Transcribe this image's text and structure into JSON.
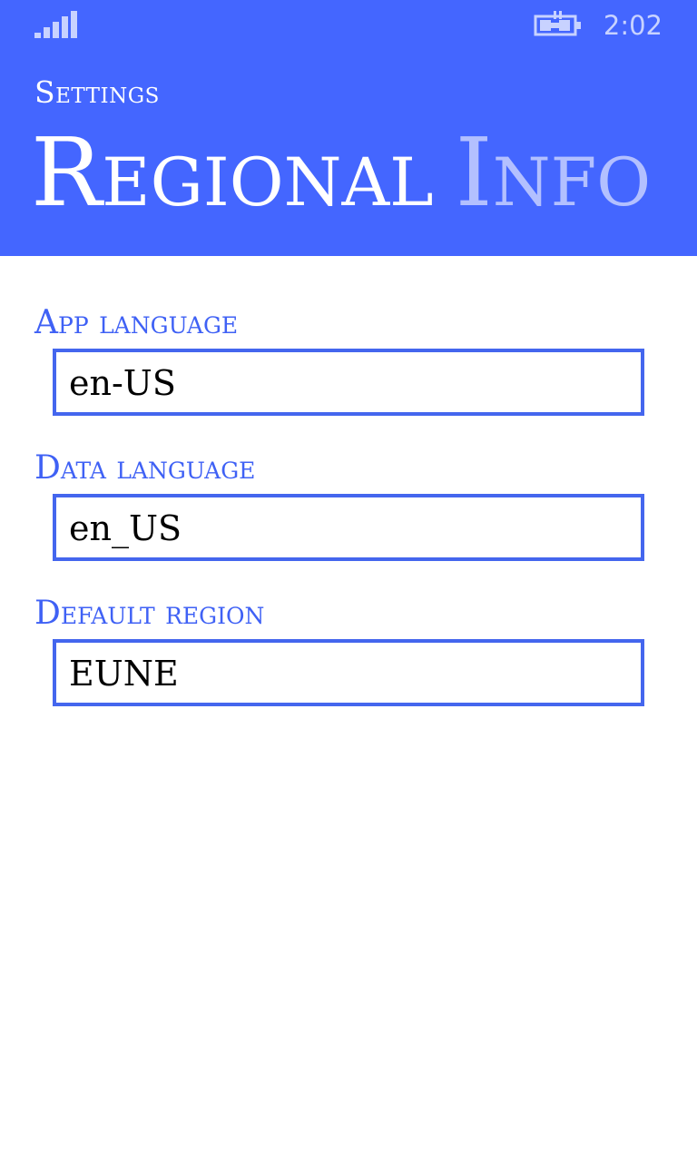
{
  "status_bar": {
    "time": "2:02",
    "signal_icon": "signal-strength-icon",
    "battery_icon": "battery-charging-icon"
  },
  "header": {
    "app_title": "Settings",
    "pivot_active": "Regional",
    "pivot_next": "Info"
  },
  "fields": {
    "app_language": {
      "label": "App language",
      "value": "en-US"
    },
    "data_language": {
      "label": "Data language",
      "value": "en_US"
    },
    "default_region": {
      "label": "Default region",
      "value": "EUNE"
    }
  },
  "colors": {
    "header_background": "#4466ff",
    "accent": "#3f61f5",
    "inactive_pivot": "#b3c0ff"
  }
}
